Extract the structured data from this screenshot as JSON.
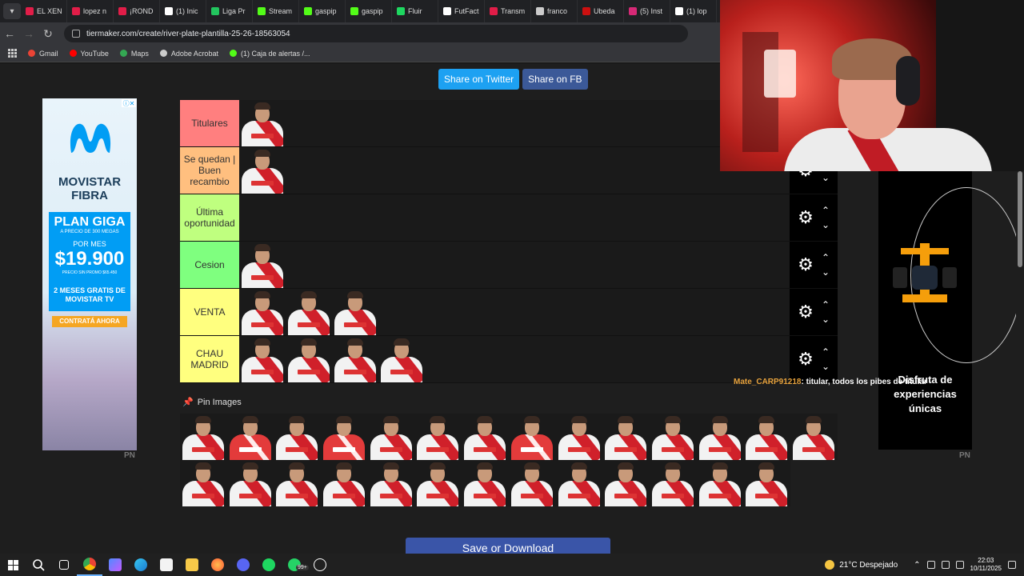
{
  "browser": {
    "tabs": [
      {
        "label": "EL XEN",
        "color": "#e11d48"
      },
      {
        "label": "lopez n",
        "color": "#e11d48"
      },
      {
        "label": "¡ROND",
        "color": "#e11d48"
      },
      {
        "label": "(1) Inic",
        "color": "#ffffff"
      },
      {
        "label": "Liga Pr",
        "color": "#22c55e"
      },
      {
        "label": "Stream",
        "color": "#53fc18"
      },
      {
        "label": "gaspip",
        "color": "#53fc18"
      },
      {
        "label": "gaspip",
        "color": "#53fc18"
      },
      {
        "label": "Fluir",
        "color": "#1ed760"
      },
      {
        "label": "FutFact",
        "color": "#ffffff"
      },
      {
        "label": "Transm",
        "color": "#e11d48"
      },
      {
        "label": "franco",
        "color": "#cccccc"
      },
      {
        "label": "Ubeda",
        "color": "#cc1010"
      },
      {
        "label": "(5) Inst",
        "color": "#d62976"
      },
      {
        "label": "(1) lop",
        "color": "#ffffff"
      }
    ],
    "url": "tiermaker.com/create/river-plate-plantilla-25-26-18563054",
    "bookmarks": [
      {
        "label": "Gmail",
        "color": "#ea4335"
      },
      {
        "label": "YouTube",
        "color": "#ff0000"
      },
      {
        "label": "Maps",
        "color": "#34a853"
      },
      {
        "label": "Adobe Acrobat",
        "color": "#cccccc"
      },
      {
        "label": "(1) Caja de alertas /...",
        "color": "#53fc18"
      }
    ]
  },
  "share": {
    "twitter": "Share on Twitter",
    "facebook": "Share on FB"
  },
  "ad_left": {
    "title": "MOVISTAR FIBRA",
    "plan": "PLAN GIGA",
    "plan_sub": "A PRECIO DE 300 MEGAS",
    "por_mes": "POR MES",
    "price": "$19.900",
    "price_note": "PRECIO SIN PROMO $65.450",
    "meses": "2 MESES GRATIS DE MOVISTAR TV",
    "cta": "CONTRATÁ AHORA",
    "badge": "PN"
  },
  "tiers": [
    {
      "label": "Titulares",
      "color": "#ff7f7f",
      "players": 1
    },
    {
      "label": "Se quedan | Buen recambio",
      "color": "#ffbf7f",
      "players": 1
    },
    {
      "label": "Última oportunidad",
      "color": "#bfff7f",
      "players": 0
    },
    {
      "label": "Cesion",
      "color": "#7fff7f",
      "players": 1
    },
    {
      "label": "VENTA",
      "color": "#ffff7f",
      "players": 3
    },
    {
      "label": "CHAU MADRID",
      "color": "#ffff7f",
      "players": 4
    }
  ],
  "pin_title": "Pin Images",
  "pool": {
    "count": 27,
    "red_indices": [
      1,
      3,
      7
    ]
  },
  "save_button": "Save or Download",
  "ad_right": {
    "text": "Disfruta de experiencias únicas",
    "badge": "PN"
  },
  "chat": {
    "user": "Mate_CARP91218",
    "message": ": titular, todos los pibes de titular"
  },
  "taskbar": {
    "weather": "21°C  Despejado",
    "time": "22:03",
    "date": "10/11/2025",
    "badge": "99+"
  }
}
